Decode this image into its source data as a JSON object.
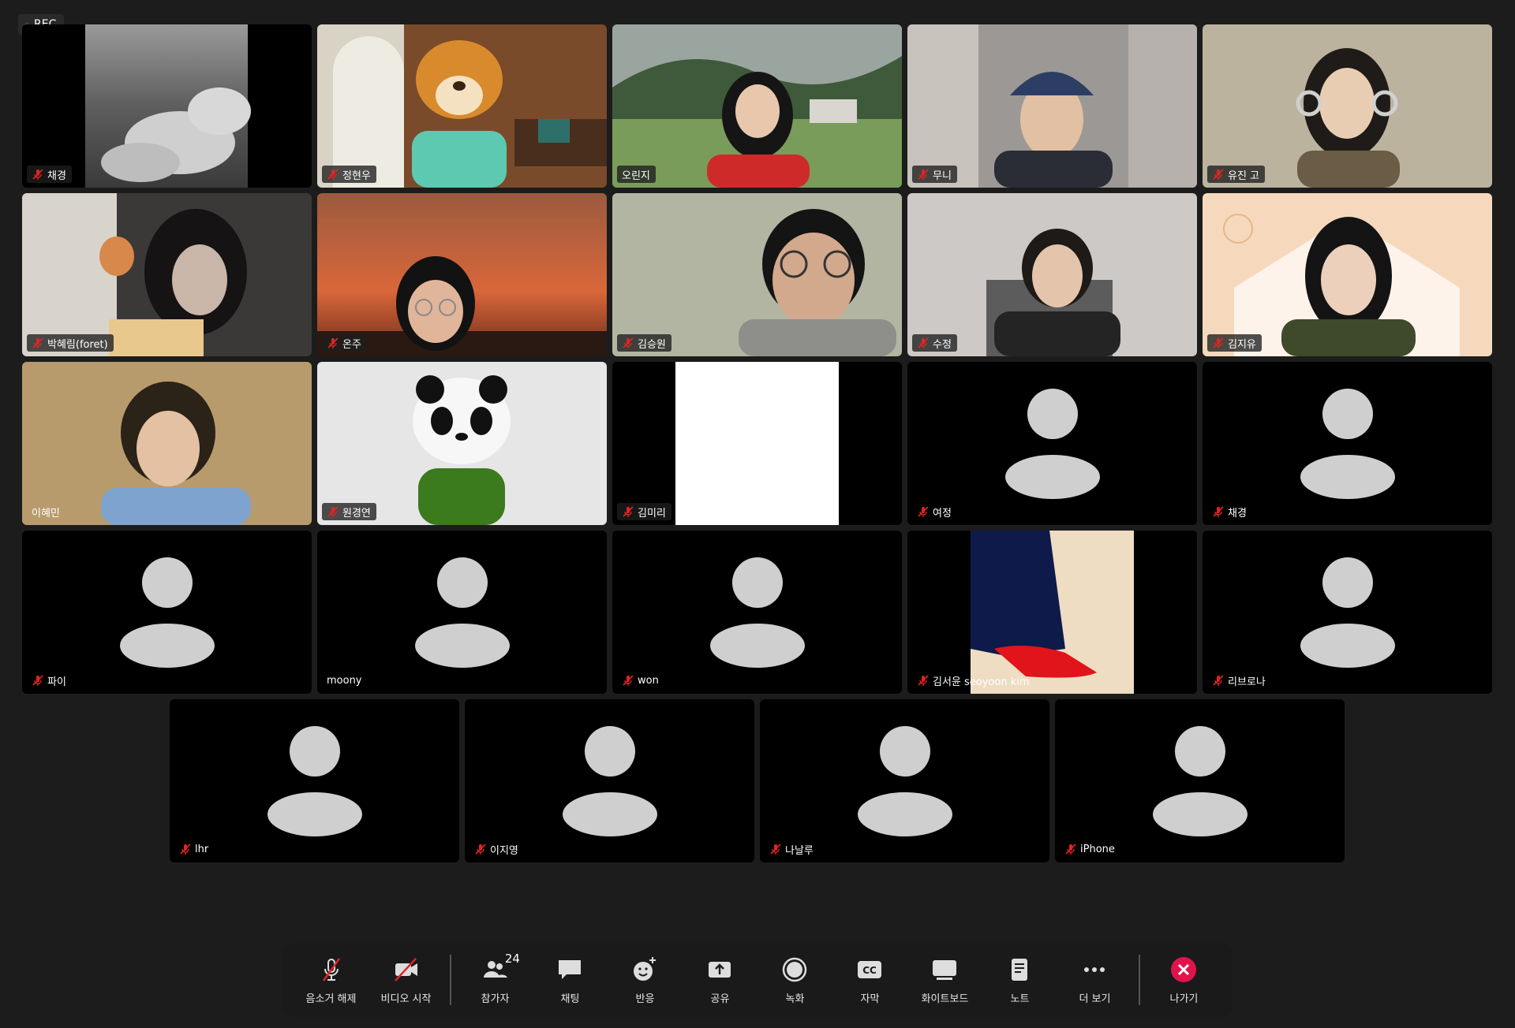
{
  "recording": {
    "label": "REC"
  },
  "tiles": [
    {
      "name": "채경",
      "muted": true
    },
    {
      "name": "정현우",
      "muted": true
    },
    {
      "name": "오린지",
      "muted": false,
      "active": true
    },
    {
      "name": "무니",
      "muted": true
    },
    {
      "name": "유진 고",
      "muted": true
    },
    {
      "name": "박혜림(foret)",
      "muted": true
    },
    {
      "name": "온주",
      "muted": true
    },
    {
      "name": "김승원",
      "muted": true
    },
    {
      "name": "수정",
      "muted": true
    },
    {
      "name": "김지유",
      "muted": true
    },
    {
      "name": "이혜민",
      "muted": false
    },
    {
      "name": "원경연",
      "muted": true
    },
    {
      "name": "김미리",
      "muted": true
    },
    {
      "name": "여정",
      "muted": true
    },
    {
      "name": "채경",
      "muted": true
    },
    {
      "name": "파이",
      "muted": true
    },
    {
      "name": "moony",
      "muted": false
    },
    {
      "name": "won",
      "muted": true
    },
    {
      "name": "김서윤 seoyoon kim",
      "muted": true
    },
    {
      "name": "리브로나",
      "muted": true
    },
    {
      "name": "lhr",
      "muted": true
    },
    {
      "name": "이지영",
      "muted": true
    },
    {
      "name": "나날루",
      "muted": true
    },
    {
      "name": "iPhone",
      "muted": true
    }
  ],
  "toolbar": {
    "unmute": "음소거 해제",
    "start_video": "비디오 시작",
    "participants": "참가자",
    "participants_count": "24",
    "chat": "채팅",
    "reactions": "반응",
    "share": "공유",
    "record": "녹화",
    "captions": "자막",
    "captions_icon_text": "CC",
    "whiteboard": "화이트보드",
    "notes": "노트",
    "more": "더 보기",
    "leave": "나가기"
  }
}
